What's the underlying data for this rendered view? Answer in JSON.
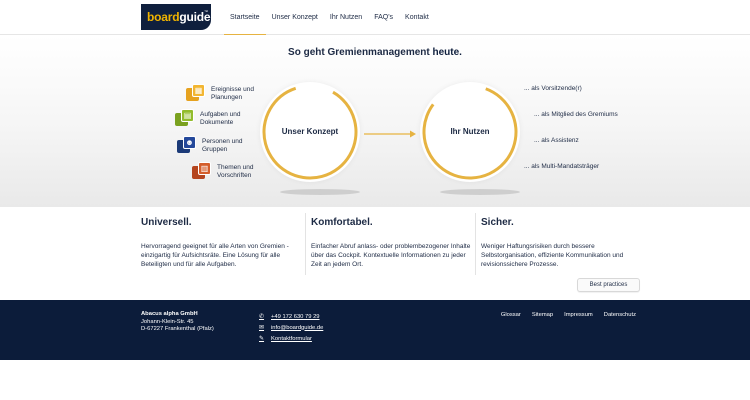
{
  "header": {
    "logo_board": "board",
    "logo_guide": "guide",
    "logo_tm": "™",
    "nav": [
      "Startseite",
      "Unser Konzept",
      "Ihr Nutzen",
      "FAQ's",
      "Kontakt"
    ],
    "active_nav": "Startseite"
  },
  "hero": {
    "title_prefix": "So geht Gremienmanagement ",
    "title_emph": "heute.",
    "features": [
      {
        "label": "Ereignisse und\nPlanungen",
        "icon": "calendar-icon",
        "color_back": "#e6a21f",
        "color_front": "#f2b632"
      },
      {
        "label": "Aufgaben und\nDokumente",
        "icon": "documents-icon",
        "color_back": "#7aa11f",
        "color_front": "#92bc2c"
      },
      {
        "label": "Personen und\nGruppen",
        "icon": "people-icon",
        "color_back": "#1b3a78",
        "color_front": "#24489a"
      },
      {
        "label": "Themen und\nVorschriften",
        "icon": "topics-icon",
        "color_back": "#b5451e",
        "color_front": "#d45d2a"
      }
    ],
    "circle_left": "Unser Konzept",
    "circle_right": "Ihr Nutzen",
    "roles": [
      "... als Vorsitzende(r)",
      "... als Mitglied des Gremiums",
      "... als Assistenz",
      "... als Multi-Mandatsträger"
    ],
    "accent": "#e6b341"
  },
  "columns": [
    {
      "title": "Universell.",
      "text": "Hervorragend geeignet für alle Arten von Gremien - einzigartig für Aufsichtsräte. Eine Lösung für alle Beteiligten und für alle Aufgaben."
    },
    {
      "title": "Komfortabel.",
      "text": "Einfacher Abruf anlass- oder problembezogener Inhalte über das Cockpit. Kontextuelle Informationen zu jeder Zeit an jedem Ort."
    },
    {
      "title": "Sicher.",
      "text": "Weniger Haftungsrisiken durch bessere Selbstorganisation, effiziente Kommunikation und revisionssichere Prozesse."
    }
  ],
  "best_practices": "Best practices",
  "footer": {
    "company": "Abacus alpha GmbH",
    "street": "Johann-Klein-Str. 45",
    "city": "D-67227 Frankenthal (Pfalz)",
    "phone": "+49 172 630 79 29",
    "email": "info@boardguide.de",
    "form": "Kontaktformular",
    "links": [
      "Glossar",
      "Sitemap",
      "Impressum",
      "Datenschutz"
    ],
    "bg": "#0c1c3a"
  }
}
